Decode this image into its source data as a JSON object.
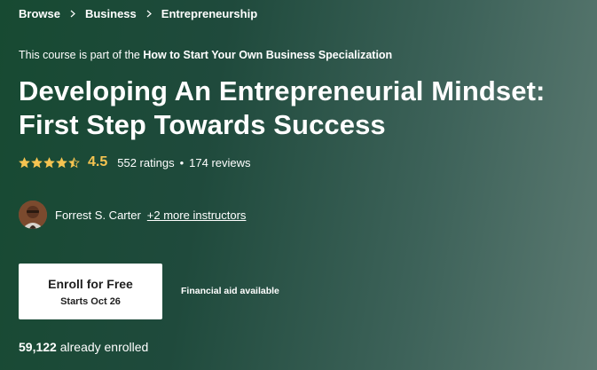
{
  "breadcrumb": [
    "Browse",
    "Business",
    "Entrepreneurship"
  ],
  "specialization": {
    "prefix": "This course is part of the",
    "name": "How to Start Your Own Business Specialization"
  },
  "course": {
    "title_line1": "Developing An Entrepreneurial Mindset:",
    "title_line2": "First Step Towards Success"
  },
  "rating": {
    "stars": 4.5,
    "value": "4.5",
    "ratings_text": "552 ratings",
    "separator": "•",
    "reviews_text": "174 reviews",
    "star_color": "#f5c451"
  },
  "instructor": {
    "name": "Forrest S. Carter",
    "more": "+2 more instructors"
  },
  "enroll": {
    "label": "Enroll for Free",
    "sub": "Starts Oct 26"
  },
  "financial_aid": "Financial aid available",
  "enrolled": {
    "count": "59,122",
    "suffix": "already enrolled"
  },
  "icons": {
    "chevron": "chevron-right-icon",
    "star": "star-icon",
    "avatar": "avatar"
  }
}
